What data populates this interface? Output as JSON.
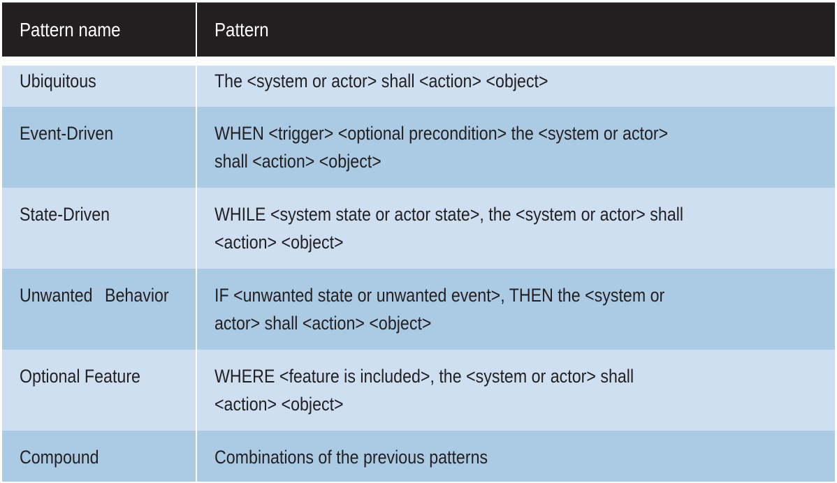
{
  "table": {
    "headers": [
      "Pattern name",
      "Pattern"
    ],
    "rows": [
      {
        "name": [
          "Ubiquitous"
        ],
        "pattern": [
          "The <system or actor> shall <action> <object>"
        ]
      },
      {
        "name": [
          "Event-Driven"
        ],
        "pattern": [
          "WHEN <trigger> <optional precondition> the <system or actor>",
          "shall <action> <object>"
        ]
      },
      {
        "name": [
          "State-Driven"
        ],
        "pattern": [
          "WHILE <system state or actor state>, the <system or actor> shall",
          "<action> <object>"
        ]
      },
      {
        "name": [
          "Unwanted",
          "Behavior"
        ],
        "pattern": [
          "IF <unwanted state or unwanted event>, THEN the <system or",
          "actor> shall <action> <object>"
        ]
      },
      {
        "name": [
          "Optional Feature"
        ],
        "pattern": [
          "WHERE <feature is included>, the <system or actor> shall",
          "<action> <object>"
        ]
      },
      {
        "name": [
          "Compound"
        ],
        "pattern": [
          "Combinations of the previous patterns"
        ]
      }
    ]
  },
  "colors": {
    "header_bg": "#231f20",
    "row_light": "#cddff0",
    "row_dark": "#abcae3"
  }
}
